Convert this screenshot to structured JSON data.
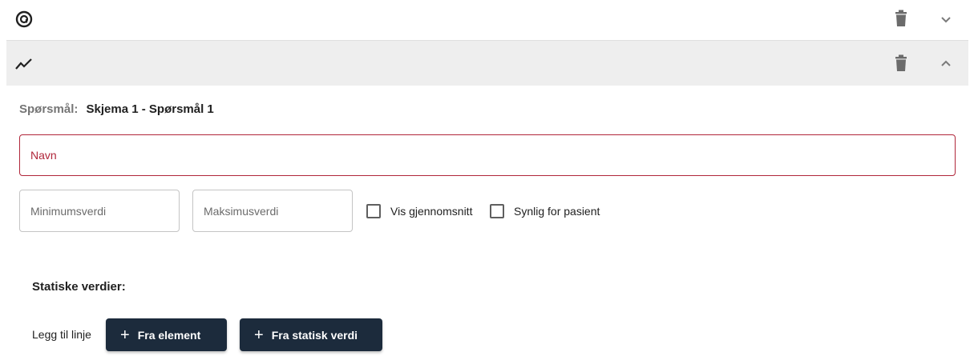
{
  "rows": [
    {
      "icon": "radio-target-icon",
      "expanded": false
    },
    {
      "icon": "trend-line-icon",
      "expanded": true
    }
  ],
  "question": {
    "label": "Spørsmål:",
    "value": "Skjema 1 - Spørsmål 1"
  },
  "fields": {
    "name_placeholder": "Navn",
    "min_placeholder": "Minimumsverdi",
    "max_placeholder": "Maksimusverdi"
  },
  "checkboxes": {
    "show_average": {
      "label": "Vis gjennomsnitt",
      "checked": false
    },
    "visible_patient": {
      "label": "Synlig for pasient",
      "checked": false
    }
  },
  "static_values": {
    "title": "Statiske verdier:",
    "add_line_label": "Legg til linje",
    "from_element_label": "Fra element",
    "from_static_label": "Fra statisk verdi"
  },
  "colors": {
    "error": "#b0263a",
    "button_bg": "#1c2b3c",
    "expanded_row_bg": "#eeeeee"
  }
}
